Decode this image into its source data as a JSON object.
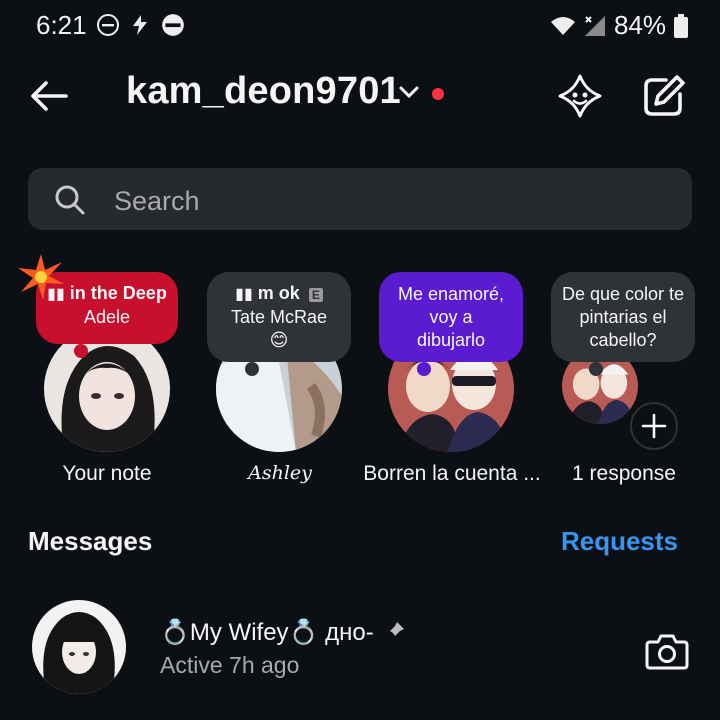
{
  "status_bar": {
    "time": "6:21",
    "battery": "84%"
  },
  "header": {
    "username": "kam_deon9701"
  },
  "search": {
    "placeholder": "Search"
  },
  "notes": [
    {
      "song_title": "in the Deep",
      "artist": "Adele",
      "label": "Your note"
    },
    {
      "song_title": "m ok",
      "explicit_badge": "E",
      "artist": "Tate McRae",
      "emoji": "😊",
      "label": "Ashley"
    },
    {
      "text": "Me enamoré, voy a dibujarlo",
      "label": "Borren la cuenta ..."
    },
    {
      "text": "De que color te pintarias el cabello?",
      "label": "1 response"
    }
  ],
  "messages": {
    "title": "Messages",
    "requests": "Requests",
    "chats": [
      {
        "name": "💍My Wifey💍 дно-",
        "status": "Active 7h ago"
      }
    ]
  },
  "colors": {
    "accent": "#3797f0",
    "note_red": "#c8102e",
    "note_purple": "#5b1bd1",
    "note_gray": "#2f3236",
    "unread_dot": "#ff3040"
  }
}
